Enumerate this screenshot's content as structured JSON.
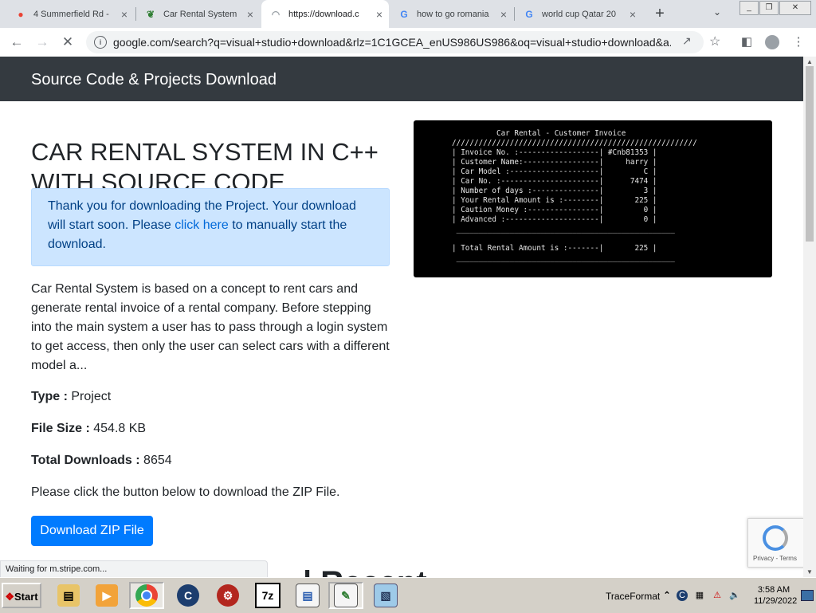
{
  "browser": {
    "tabs": [
      {
        "label": "4 Summerfield Rd -",
        "icon": "maps-pin-icon"
      },
      {
        "label": "Car Rental System",
        "icon": "feather-icon"
      },
      {
        "label": "https://download.c",
        "icon": "loading-icon"
      },
      {
        "label": "how to go romania",
        "icon": "google-g-icon"
      },
      {
        "label": "world cup Qatar 20",
        "icon": "google-g-icon"
      }
    ],
    "url": "google.com/search?q=visual+studio+download&rlz=1C1GCEA_enUS986US986&oq=visual+studio+download&a..."
  },
  "page": {
    "brand": "Source Code & Projects Download",
    "title": "CAR RENTAL SYSTEM IN C++ WITH SOURCE CODE",
    "alert_before": "Thank you for downloading the Project. Your download will start soon. Please ",
    "alert_link": "click here",
    "alert_after": " to manually start the download.",
    "description": "Car Rental System is based on a concept to rent cars and generate rental invoice of a rental company. Before stepping into the main system a user has to pass through a login system to get access, then only the user can select cars with a different model a...",
    "type_label": "Type :",
    "type_value": " Project",
    "size_label": "File Size :",
    "size_value": " 454.8 KB",
    "downloads_label": "Total Downloads :",
    "downloads_value": " 8654",
    "instruction": "Please click the button below to download the ZIP File.",
    "download_button": "Download ZIP File",
    "partial_heading": "| Recent"
  },
  "terminal": {
    "text": "          Car Rental - Customer Invoice\n///////////////////////////////////////////////////////\n| Invoice No. :------------------| #Cnb81353 |\n| Customer Name:-----------------|     harry |\n| Car Model :--------------------|         C |\n| Car No. :----------------------|      7474 |\n| Number of days :---------------|         3 |\n| Your Rental Amount is :--------|       225 |\n| Caution Money :----------------|         0 |\n| Advanced :---------------------|         0 |\n _________________________________________________\n\n| Total Rental Amount is :-------|       225 |\n _________________________________________________"
  },
  "recaptcha": {
    "terms": "Privacy - Terms"
  },
  "status_text": "Waiting for m.stripe.com...",
  "taskbar": {
    "start": "Start",
    "tray_label": "TraceFormat",
    "time": "3:58 AM",
    "date": "11/29/2022"
  }
}
